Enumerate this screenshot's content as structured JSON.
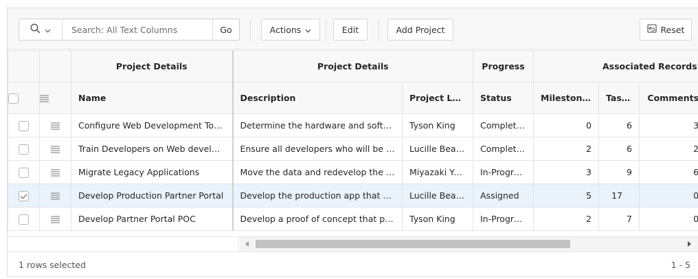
{
  "toolbar": {
    "search_placeholder": "Search: All Text Columns",
    "go_label": "Go",
    "actions_label": "Actions",
    "edit_label": "Edit",
    "add_project_label": "Add Project",
    "reset_label": "Reset"
  },
  "grid": {
    "group_headers": {
      "project_details_1": "Project Details",
      "project_details_2": "Project Details",
      "progress": "Progress",
      "associated_records": "Associated Records"
    },
    "columns": {
      "name": "Name",
      "description": "Description",
      "project_lead": "Project Lead",
      "status": "Status",
      "milestones": "Milestones",
      "tasks": "Tasks",
      "comments": "Comments"
    },
    "rows": [
      {
        "name": "Configure Web Development Too...",
        "description": "Determine the hardware and softwa...",
        "lead": "Tyson King",
        "status": "Completed",
        "milestones": "0",
        "tasks": "6",
        "comments": "3",
        "selected": false
      },
      {
        "name": "Train Developers on Web develop...",
        "description": "Ensure all developers who will be d...",
        "lead": "Lucille Beatie",
        "status": "Completed",
        "milestones": "2",
        "tasks": "6",
        "comments": "2",
        "selected": false
      },
      {
        "name": "Migrate Legacy Applications",
        "description": "Move the data and redevelop the a...",
        "lead": "Miyazaki Yo...",
        "status": "In-Progress",
        "milestones": "3",
        "tasks": "9",
        "comments": "6",
        "selected": false
      },
      {
        "name": "Develop Production Partner Portal",
        "description": "Develop the production app that pa...",
        "lead": "Lucille Beatie",
        "status": "Assigned",
        "milestones": "5",
        "tasks": "17",
        "comments": "0",
        "selected": true
      },
      {
        "name": "Develop Partner Portal POC",
        "description": "Develop a proof of concept that par...",
        "lead": "Tyson King",
        "status": "In-Progress",
        "milestones": "2",
        "tasks": "7",
        "comments": "0",
        "selected": false
      }
    ]
  },
  "footer": {
    "selection_text": "1 rows selected",
    "pagination": "1 - 5"
  },
  "colors": {
    "selected_row": "#eaf3fb",
    "header_bg": "#f8f8f8",
    "border": "#e4e4e4"
  }
}
